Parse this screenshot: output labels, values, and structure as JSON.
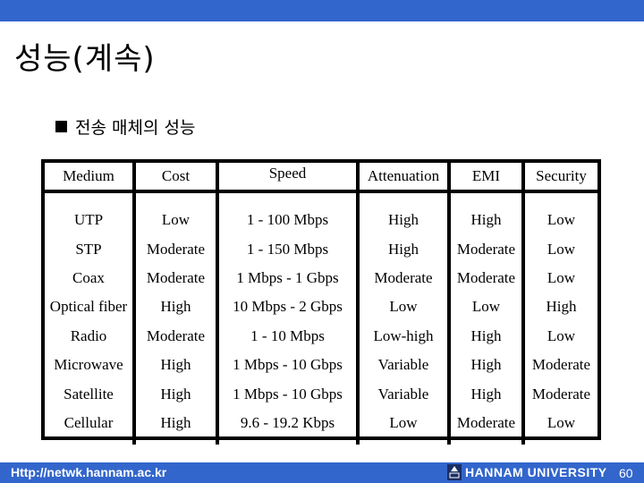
{
  "slide": {
    "title": "성능(계속)",
    "subtitle": "전송 매체의 성능"
  },
  "table": {
    "headers": [
      "Medium",
      "Cost",
      "Speed",
      "Attenuation",
      "EMI",
      "Security"
    ],
    "rows": [
      [
        "UTP",
        "Low",
        "1 - 100 Mbps",
        "High",
        "High",
        "Low"
      ],
      [
        "STP",
        "Moderate",
        "1 - 150 Mbps",
        "High",
        "Moderate",
        "Low"
      ],
      [
        "Coax",
        "Moderate",
        "1 Mbps - 1 Gbps",
        "Moderate",
        "Moderate",
        "Low"
      ],
      [
        "Optical fiber",
        "High",
        "10 Mbps - 2 Gbps",
        "Low",
        "Low",
        "High"
      ],
      [
        "Radio",
        "Moderate",
        "1 - 10 Mbps",
        "Low-high",
        "High",
        "Low"
      ],
      [
        "Microwave",
        "High",
        "1 Mbps - 10 Gbps",
        "Variable",
        "High",
        "Moderate"
      ],
      [
        "Satellite",
        "High",
        "1 Mbps - 10 Gbps",
        "Variable",
        "High",
        "Moderate"
      ],
      [
        "Cellular",
        "High",
        "9.6 - 19.2 Kbps",
        "Low",
        "Moderate",
        "Low"
      ]
    ]
  },
  "footer": {
    "url": "Http://netwk.hannam.ac.kr",
    "university": "HANNAM UNIVERSITY",
    "page_number": "60",
    "logo_icon": "university-crest-icon"
  },
  "colors": {
    "bar": "#3366cc"
  }
}
